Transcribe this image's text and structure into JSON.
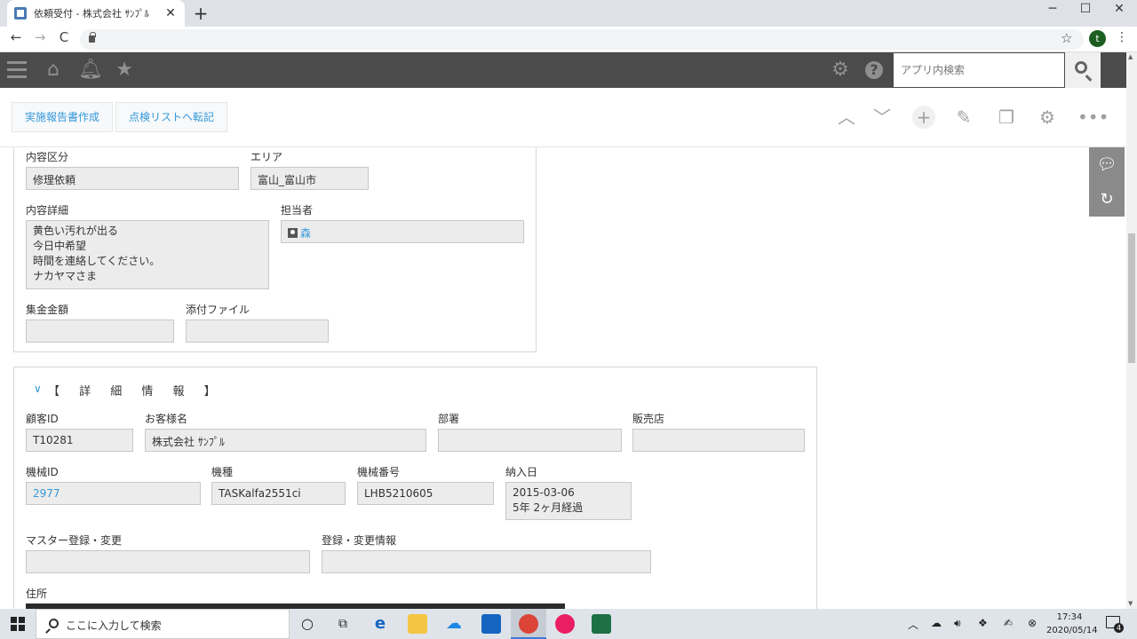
{
  "browser": {
    "tab_title": "依頼受付 - 株式会社 ｻﾝﾌﾟﾙ",
    "tab_close": "✕",
    "new_tab": "+",
    "minimize": "─",
    "maximize": "☐",
    "close": "✕",
    "back": "←",
    "forward": "→",
    "reload": "C",
    "bookmark": "☆",
    "profile_initial": "t",
    "menu": "⋮"
  },
  "header": {
    "search_placeholder": "アプリ内検索"
  },
  "toolbar": {
    "btn_report": "実施報告書作成",
    "btn_checklist": "点検リストへ転記"
  },
  "group1": {
    "naiyo_kubun_label": "内容区分",
    "naiyo_kubun_value": "修理依頼",
    "area_label": "エリア",
    "area_value": "富山_富山市",
    "naiyo_shosai_label": "内容詳細",
    "naiyo_shosai_lines": [
      "黄色い汚れが出る",
      "今日中希望",
      "時間を連絡してください。",
      "ナカヤマさま"
    ],
    "tantosha_label": "担当者",
    "tantosha_value": "森",
    "shukin_label": "集金金額",
    "shukin_value": "",
    "tenpu_label": "添付ファイル",
    "tenpu_value": ""
  },
  "group2": {
    "title": "【 詳 細 情 報 】",
    "kokyaku_id_label": "顧客ID",
    "kokyaku_id_value": "T10281",
    "okyakusama_label": "お客様名",
    "okyakusama_value": "株式会社 ｻﾝﾌﾟﾙ",
    "busho_label": "部署",
    "busho_value": "",
    "hanbaiten_label": "販売店",
    "hanbaiten_value": "",
    "kikai_id_label": "機械ID",
    "kikai_id_value": "2977",
    "kishu_label": "機種",
    "kishu_value": "TASKalfa2551ci",
    "kikai_bango_label": "機械番号",
    "kikai_bango_value": "LHB5210605",
    "nonyubi_label": "納入日",
    "nonyubi_date": "2015-03-06",
    "nonyubi_elapsed": "5年 2ヶ月経過",
    "master_label": "マスター登録・変更",
    "master_value": "",
    "toroku_label": "登録・変更情報",
    "toroku_value": "",
    "jusho_label": "住所"
  },
  "taskbar": {
    "search_text": "ここに入力して検索",
    "time": "17:34",
    "date": "2020/05/14",
    "notification_count": "4"
  },
  "colors": {
    "header_bg": "#4b4b4b",
    "link": "#3498db",
    "field_bg": "#ececec"
  }
}
